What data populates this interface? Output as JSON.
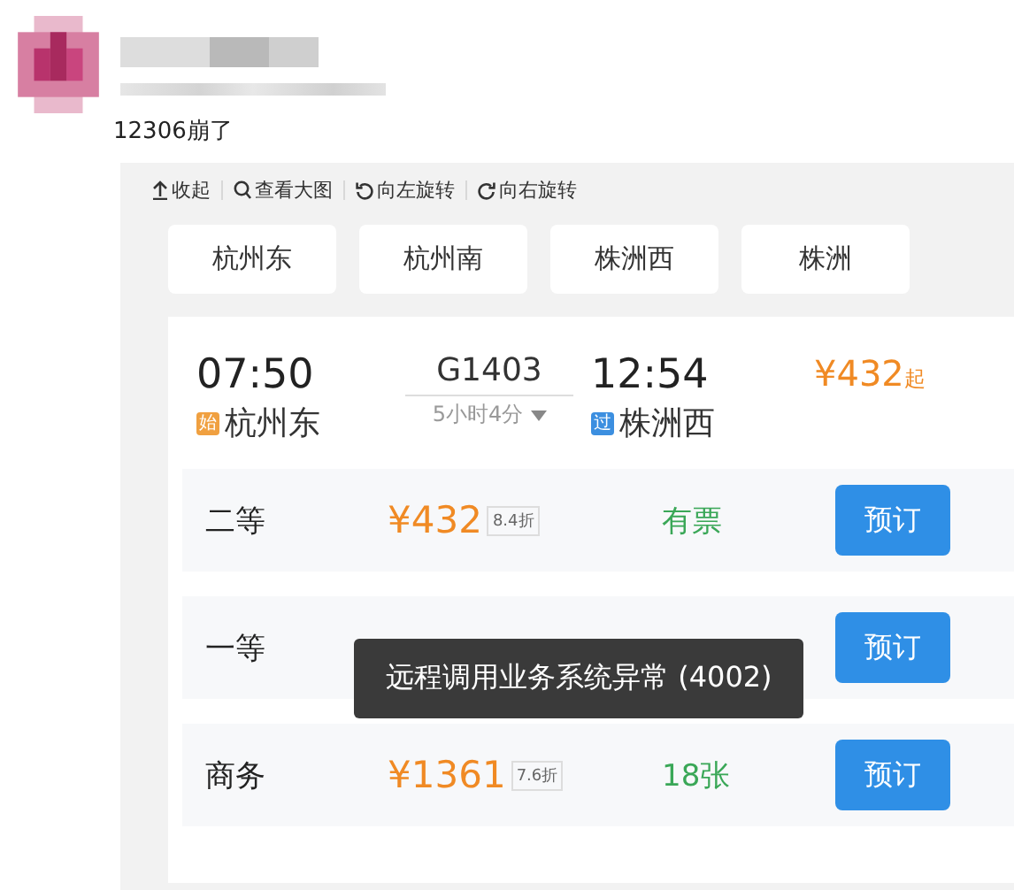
{
  "post": {
    "text": "12306崩了"
  },
  "toolbar": [
    {
      "kind": "collapse",
      "label": "收起"
    },
    {
      "kind": "zoom",
      "label": "查看大图"
    },
    {
      "kind": "rotate-left",
      "label": "向左旋转"
    },
    {
      "kind": "rotate-right",
      "label": "向右旋转"
    }
  ],
  "stations": [
    "杭州东",
    "杭州南",
    "株洲西",
    "株洲"
  ],
  "train": {
    "depart_time": "07:50",
    "depart_badge": "始",
    "depart_station": "杭州东",
    "number": "G1403",
    "duration": "5小时4分",
    "arrive_time": "12:54",
    "arrive_badge": "过",
    "arrive_station": "株洲西",
    "price": "¥432",
    "price_suffix": "起"
  },
  "seats": [
    {
      "class": "二等",
      "price": "¥432",
      "discount": "8.4折",
      "availability": "有票",
      "button": "预订"
    },
    {
      "class": "一等",
      "button": "预订"
    },
    {
      "class": "商务",
      "price": "¥1361",
      "discount": "7.6折",
      "availability": "18张",
      "button": "预订"
    }
  ],
  "toast": "远程调用业务系统异常 (4002)"
}
